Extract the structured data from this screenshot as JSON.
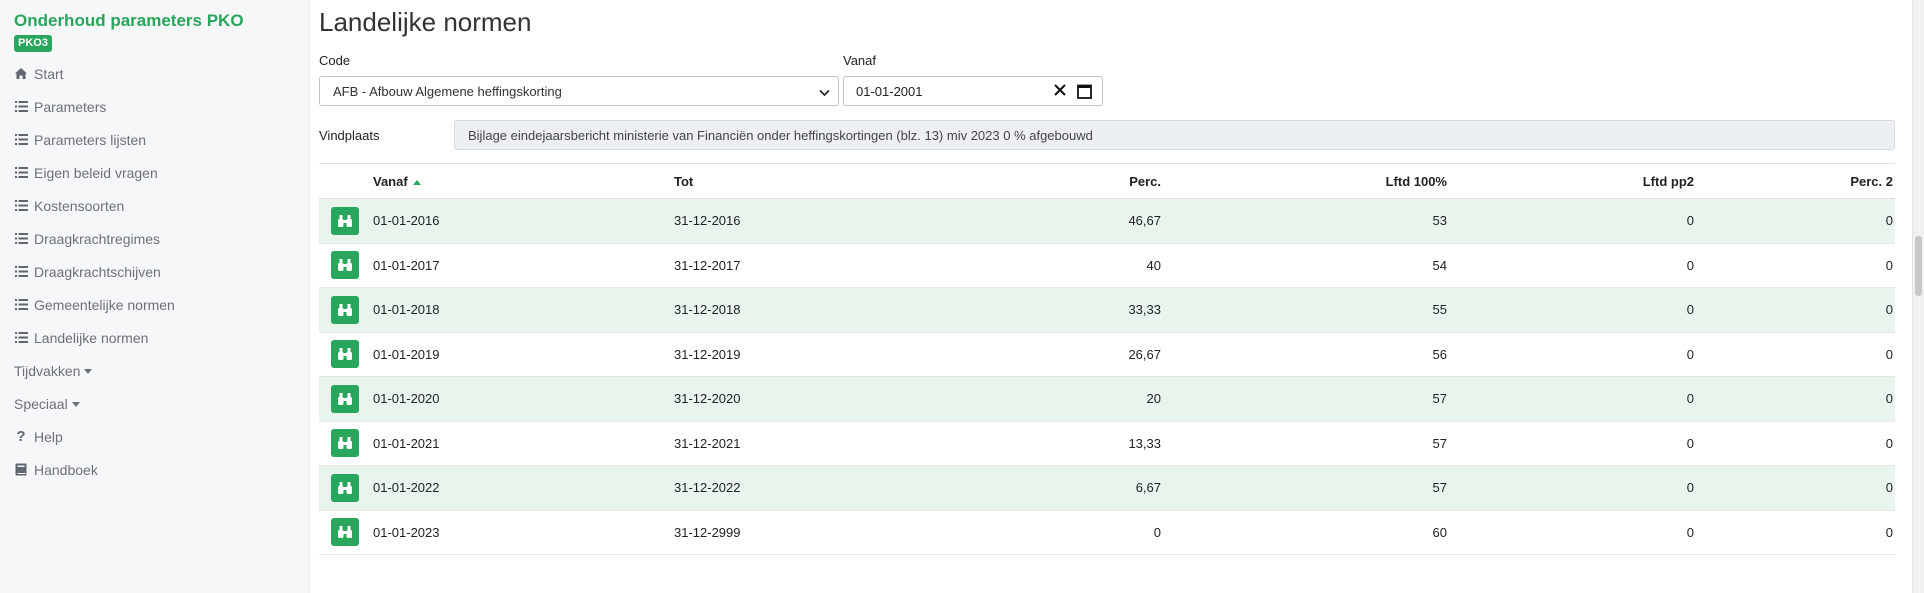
{
  "sidebar": {
    "app_title": "Onderhoud parameters PKO",
    "badge": "PKO3",
    "items": [
      {
        "label": "Start",
        "icon": "home-icon"
      },
      {
        "label": "Parameters",
        "icon": "list-icon"
      },
      {
        "label": "Parameters lijsten",
        "icon": "list-icon"
      },
      {
        "label": "Eigen beleid vragen",
        "icon": "list-icon"
      },
      {
        "label": "Kostensoorten",
        "icon": "list-icon"
      },
      {
        "label": "Draagkrachtregimes",
        "icon": "list-icon"
      },
      {
        "label": "Draagkrachtschijven",
        "icon": "list-icon"
      },
      {
        "label": "Gemeentelijke normen",
        "icon": "list-icon"
      },
      {
        "label": "Landelijke normen",
        "icon": "list-icon"
      },
      {
        "label": "Tijdvakken",
        "icon": "dropdown-caret"
      },
      {
        "label": "Speciaal",
        "icon": "dropdown-caret"
      },
      {
        "label": "Help",
        "icon": "question-icon"
      },
      {
        "label": "Handboek",
        "icon": "book-icon"
      }
    ]
  },
  "main": {
    "title": "Landelijke normen",
    "code_label": "Code",
    "code_value": "AFB - Afbouw Algemene heffingskorting",
    "vanaf_label": "Vanaf",
    "vanaf_value": "01-01-2001",
    "vindplaats_label": "Vindplaats",
    "vindplaats_value": "Bijlage eindejaarsbericht ministerie van Financiën onder heffingskortingen (blz. 13) miv 2023 0 % afgebouwd"
  },
  "table": {
    "columns": [
      "Vanaf",
      "Tot",
      "Perc.",
      "Lftd 100%",
      "Lftd pp2",
      "Perc. 2"
    ],
    "rows": [
      [
        "01-01-2016",
        "31-12-2016",
        "46,67",
        "53",
        "0",
        "0"
      ],
      [
        "01-01-2017",
        "31-12-2017",
        "40",
        "54",
        "0",
        "0"
      ],
      [
        "01-01-2018",
        "31-12-2018",
        "33,33",
        "55",
        "0",
        "0"
      ],
      [
        "01-01-2019",
        "31-12-2019",
        "26,67",
        "56",
        "0",
        "0"
      ],
      [
        "01-01-2020",
        "31-12-2020",
        "20",
        "57",
        "0",
        "0"
      ],
      [
        "01-01-2021",
        "31-12-2021",
        "13,33",
        "57",
        "0",
        "0"
      ],
      [
        "01-01-2022",
        "31-12-2022",
        "6,67",
        "57",
        "0",
        "0"
      ],
      [
        "01-01-2023",
        "31-12-2999",
        "0",
        "60",
        "0",
        "0"
      ]
    ]
  },
  "colors": {
    "accent": "#28a65b",
    "row_alt": "#e9f5ec",
    "sidebar_bg": "#f6f7f9",
    "sidebar_text": "#6b7179"
  }
}
